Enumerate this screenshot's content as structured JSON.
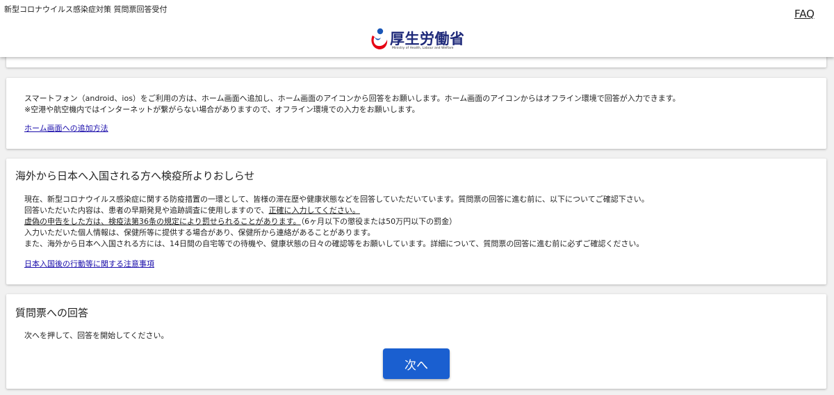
{
  "header": {
    "app_title": "新型コロナウイルス感染症対策 質問票回答受付",
    "faq_label": "FAQ",
    "logo_text": "厚生労働省",
    "logo_subtext": "Ministry of Health, Labour and Welfare"
  },
  "smartphone_notice": {
    "line1": "スマートフォン（android、ios）をご利用の方は、ホーム画面へ追加し、ホーム画面のアイコンから回答をお願いします。ホーム画面のアイコンからはオフライン環境で回答が入力できます。",
    "line2": "※空港や航空機内ではインターネットが繋がらない場合がありますので、オフライン環境での入力をお願いします。",
    "link": "ホーム画面への追加方法"
  },
  "quarantine_notice": {
    "title": "海外から日本へ入国される方へ検疫所よりおしらせ",
    "line1": "現在、新型コロナウイルス感染症に関する防疫措置の一環として、皆様の滞在歴や健康状態などを回答していただいています。質問票の回答に進む前に、以下についてご確認下さい。",
    "line2_prefix": "回答いただいた内容は、患者の早期発見や追跡調査に使用しますので、",
    "line2_emphasis": "正確に入力してください。",
    "line3_emphasis": "虚偽の申告をした方は、検疫法第36条の規定により罰せられることがあります。",
    "line3_suffix": "（6ヶ月以下の懲役または50万円以下の罰金）",
    "line4": "入力いただいた個人情報は、保健所等に提供する場合があり、保健所から連絡があることがあります。",
    "line5": "また、海外から日本へ入国される方には、14日間の自宅等での待機や、健康状態の日々の確認等をお願いしています。詳細について、質問票の回答に進む前に必ずご確認ください。",
    "link": "日本入国後の行動等に関する注意事項"
  },
  "questionnaire": {
    "title": "質問票への回答",
    "instruction": "次へを押して、回答を開始してください。",
    "next_button": "次へ"
  },
  "colors": {
    "primary_button": "#1a5fd0",
    "link": "#1a0dab",
    "logo_blue": "#1f2a7a",
    "logo_red": "#e60012"
  }
}
